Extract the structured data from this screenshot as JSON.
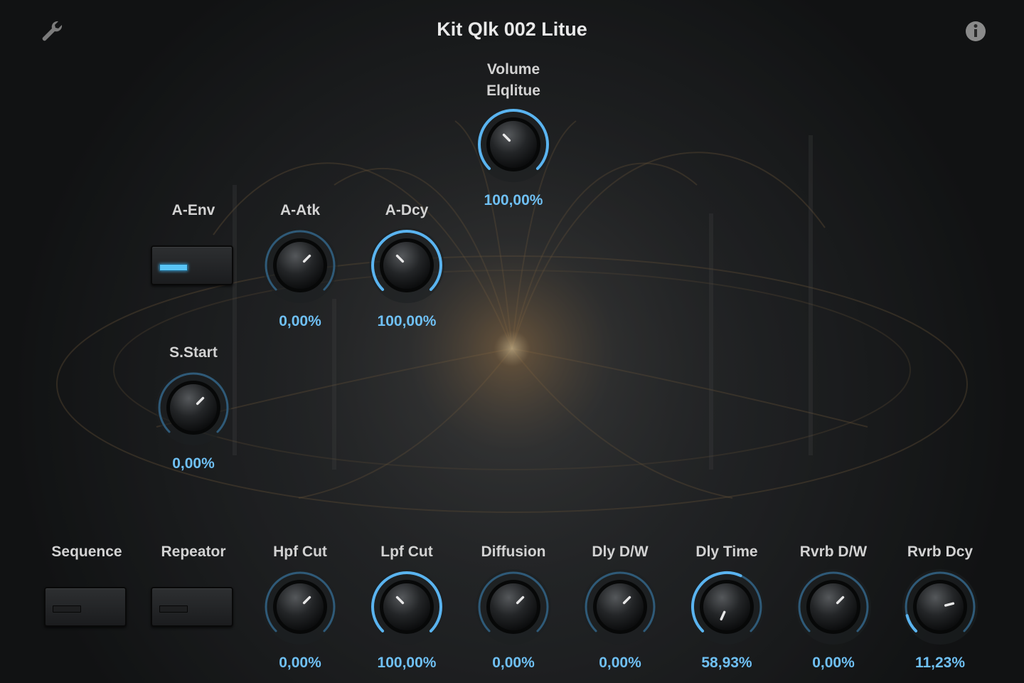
{
  "window": {
    "title": "Kit Qlk 002 Litue",
    "settings_icon": "wrench-icon",
    "info_icon": "info-icon"
  },
  "colors": {
    "accent": "#5ab4f0",
    "track": "#2f5a78",
    "value_text": "#6fc0f4",
    "label_text": "#d2d2d2"
  },
  "volume": {
    "label": "Volume\nElqlitue",
    "value": "100,00%",
    "level": 1.0
  },
  "a_env": {
    "label": "A-Env",
    "state": "on"
  },
  "a_atk": {
    "label": "A-Atk",
    "value": "0,00%",
    "level": 0.0
  },
  "a_dcy": {
    "label": "A-Dcy",
    "value": "100,00%",
    "level": 1.0
  },
  "s_start": {
    "label": "S.Start",
    "value": "0,00%",
    "level": 0.0
  },
  "sequence": {
    "label": "Sequence",
    "state": "off"
  },
  "repeator": {
    "label": "Repeator",
    "state": "off"
  },
  "hpf_cut": {
    "label": "Hpf Cut",
    "value": "0,00%",
    "level": 0.0
  },
  "lpf_cut": {
    "label": "Lpf Cut",
    "value": "100,00%",
    "level": 1.0
  },
  "diffusion": {
    "label": "Diffusion",
    "value": "0,00%",
    "level": 0.0
  },
  "dly_dw": {
    "label": "Dly D/W",
    "value": "0,00%",
    "level": 0.0
  },
  "dly_time": {
    "label": "Dly Time",
    "value": "58,93%",
    "level": 0.5893
  },
  "rvrb_dw": {
    "label": "Rvrb D/W",
    "value": "0,00%",
    "level": 0.0
  },
  "rvrb_dcy": {
    "label": "Rvrb Dcy",
    "value": "11,23%",
    "level": 0.1123
  }
}
